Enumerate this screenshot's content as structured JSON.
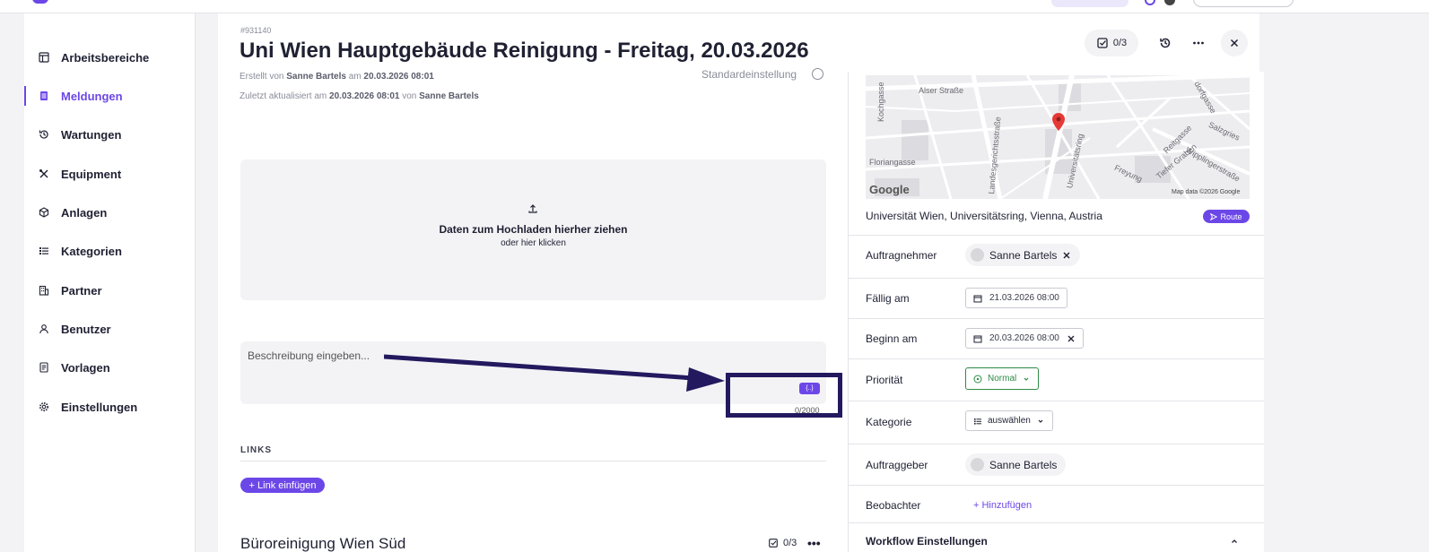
{
  "sidebar": {
    "items": [
      {
        "label": "Arbeitsbereiche",
        "icon": "workspace-icon"
      },
      {
        "label": "Meldungen",
        "icon": "document-icon",
        "active": true
      },
      {
        "label": "Wartungen",
        "icon": "history-icon"
      },
      {
        "label": "Equipment",
        "icon": "tools-icon"
      },
      {
        "label": "Anlagen",
        "icon": "cube-icon"
      },
      {
        "label": "Kategorien",
        "icon": "list-icon"
      },
      {
        "label": "Partner",
        "icon": "building-icon"
      },
      {
        "label": "Benutzer",
        "icon": "user-icon"
      },
      {
        "label": "Vorlagen",
        "icon": "template-icon"
      },
      {
        "label": "Einstellungen",
        "icon": "gear-icon"
      }
    ]
  },
  "ticket": {
    "id": "#931140",
    "title": "Uni Wien Hauptgebäude Reinigung - Freitag, 20.03.2026",
    "created_prefix": "Erstellt von",
    "created_by": "Sanne Bartels",
    "created_connector": "am",
    "created_at": "20.03.2026 08:01",
    "updated_prefix": "Zuletzt aktualisiert am",
    "updated_at": "20.03.2026 08:01",
    "updated_connector": "von",
    "updated_by": "Sanne Bartels",
    "standard_setting": "Standardeinstellung"
  },
  "header": {
    "checklist_count": "0/3"
  },
  "upload": {
    "title": "Daten zum Hochladen hierher ziehen",
    "subtitle": "oder hier klicken"
  },
  "description": {
    "placeholder": "Beschreibung eingeben...",
    "variable_button": "{..}",
    "char_count": "0/2000"
  },
  "links": {
    "heading": "LINKS",
    "add_button": "+ Link einfügen"
  },
  "subtask": {
    "title": "Büroreinigung Wien Süd",
    "checklist_count": "0/3"
  },
  "map": {
    "streets": [
      "Alser Straße",
      "Kochgasse",
      "Landesgerichtsstraße",
      "Universitätsring",
      "Floriangasse",
      "Reitgasse",
      "Freyung",
      "Tiefer Graben",
      "Wipplingerstraße",
      "Salzgries",
      "dorfgasse"
    ],
    "logo": "Google",
    "attribution": "Map data ©2026 Google"
  },
  "location": {
    "address": "Universität Wien, Universitätsring, Vienna, Austria",
    "route_button": "Route"
  },
  "fields": {
    "assignee_label": "Auftragnehmer",
    "assignee": "Sanne Bartels",
    "due_label": "Fällig am",
    "due_date": "21.03.2026 08:00",
    "start_label": "Beginn am",
    "start_date": "20.03.2026 08:00",
    "priority_label": "Priorität",
    "priority": "Normal",
    "category_label": "Kategorie",
    "category": "auswählen",
    "client_label": "Auftraggeber",
    "client": "Sanne Bartels",
    "watchers_label": "Beobachter",
    "watchers_add": "+ Hinzufügen",
    "workflow_label": "Workflow Einstellungen"
  },
  "colors": {
    "accent": "#6c47e8",
    "priority_green": "#2e8b45",
    "annotation": "#23195f",
    "map_pin": "#e53935"
  }
}
